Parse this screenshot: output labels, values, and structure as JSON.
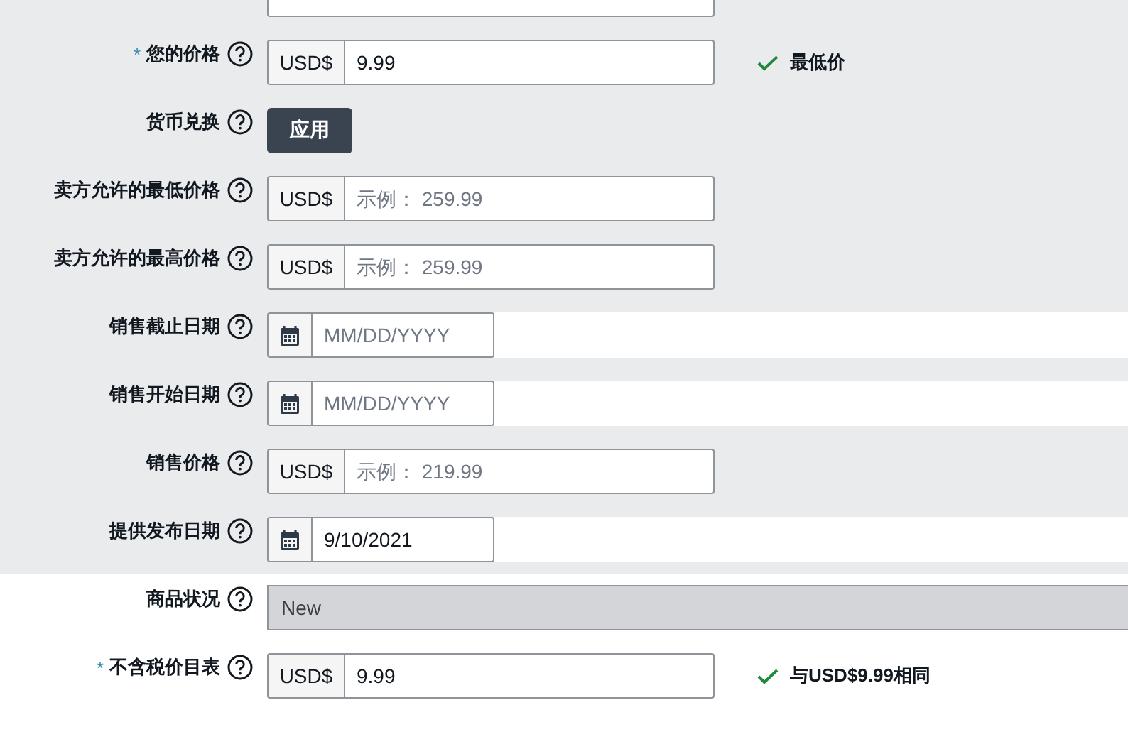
{
  "sections": [
    {
      "shaded": true,
      "rows": [
        {
          "kind": "cut"
        },
        {
          "kind": "currency",
          "label": "您的价格",
          "required_mark": "*",
          "prefix": "USD$",
          "value": "9.99",
          "status": "最低价"
        },
        {
          "kind": "button",
          "label": "货币兑换",
          "button": "应用"
        },
        {
          "kind": "currency",
          "label": "卖方允许的最低价格",
          "prefix": "USD$",
          "placeholder": "示例： 259.99"
        },
        {
          "kind": "currency",
          "label": "卖方允许的最高价格",
          "prefix": "USD$",
          "placeholder": "示例： 259.99"
        },
        {
          "kind": "date",
          "label": "销售截止日期",
          "placeholder": "MM/DD/YYYY"
        },
        {
          "kind": "date",
          "label": "销售开始日期",
          "placeholder": "MM/DD/YYYY"
        },
        {
          "kind": "currency",
          "label": "销售价格",
          "prefix": "USD$",
          "placeholder": "示例： 219.99"
        },
        {
          "kind": "date",
          "label": "提供发布日期",
          "value": "9/10/2021"
        }
      ]
    },
    {
      "shaded": false,
      "rows": [
        {
          "kind": "select",
          "label": "商品状况",
          "value": "New",
          "disabled": true
        },
        {
          "kind": "currency",
          "label": "不含税价目表",
          "required_mark": "*",
          "prefix": "USD$",
          "value": "9.99",
          "status": "与USD$9.99相同"
        }
      ]
    }
  ]
}
